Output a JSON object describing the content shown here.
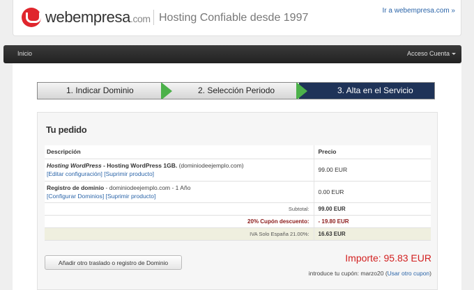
{
  "header": {
    "logo_main": "webempresa",
    "logo_domain": ".com",
    "tagline": "Hosting Confiable desde 1997",
    "site_link": "Ir a webempresa.com »"
  },
  "nav": {
    "home": "Inicio",
    "account": "Acceso Cuenta"
  },
  "steps": [
    {
      "label": "1.  Indicar Dominio",
      "active": false
    },
    {
      "label": "2.  Selección Periodo",
      "active": false
    },
    {
      "label": "3.  Alta en el Servicio",
      "active": true
    }
  ],
  "order": {
    "title": "Tu pedido",
    "col_description": "Descripción",
    "col_price": "Precio",
    "items": [
      {
        "product_italic": "Hosting WordPress",
        "product_rest": " - Hosting WordPress 1GB.",
        "domain": " (dominiodeejemplo.com)",
        "link1": "[Editar configuración]",
        "link2": "[Suprimir producto]",
        "price": "99.00 EUR"
      },
      {
        "product": "Registro de dominio",
        "detail": " - dominiodeejemplo.com - 1 Año",
        "link1": "[Configurar Dominios]",
        "link2": "[Suprimir producto]",
        "price": "0.00 EUR"
      }
    ],
    "subtotal_label": "Subtotal:",
    "subtotal_value": "99.00 EUR",
    "discount_label": "20% Cupón descuento:",
    "discount_value": "- 19.80 EUR",
    "tax_label": "IVA Solo España 21.00%:",
    "tax_value": "16.63 EUR",
    "add_button": "Añadir otro traslado o registro de Dominio",
    "total": "Importe: 95.83 EUR",
    "coupon_text": "introduce tu cupón: marzo20",
    "coupon_link": "Usar otro cupon"
  },
  "colors": {
    "accent_red": "#d21f1f",
    "step_active": "#1f3358",
    "arrow_green": "#4cb14a",
    "link": "#2a64a8"
  }
}
